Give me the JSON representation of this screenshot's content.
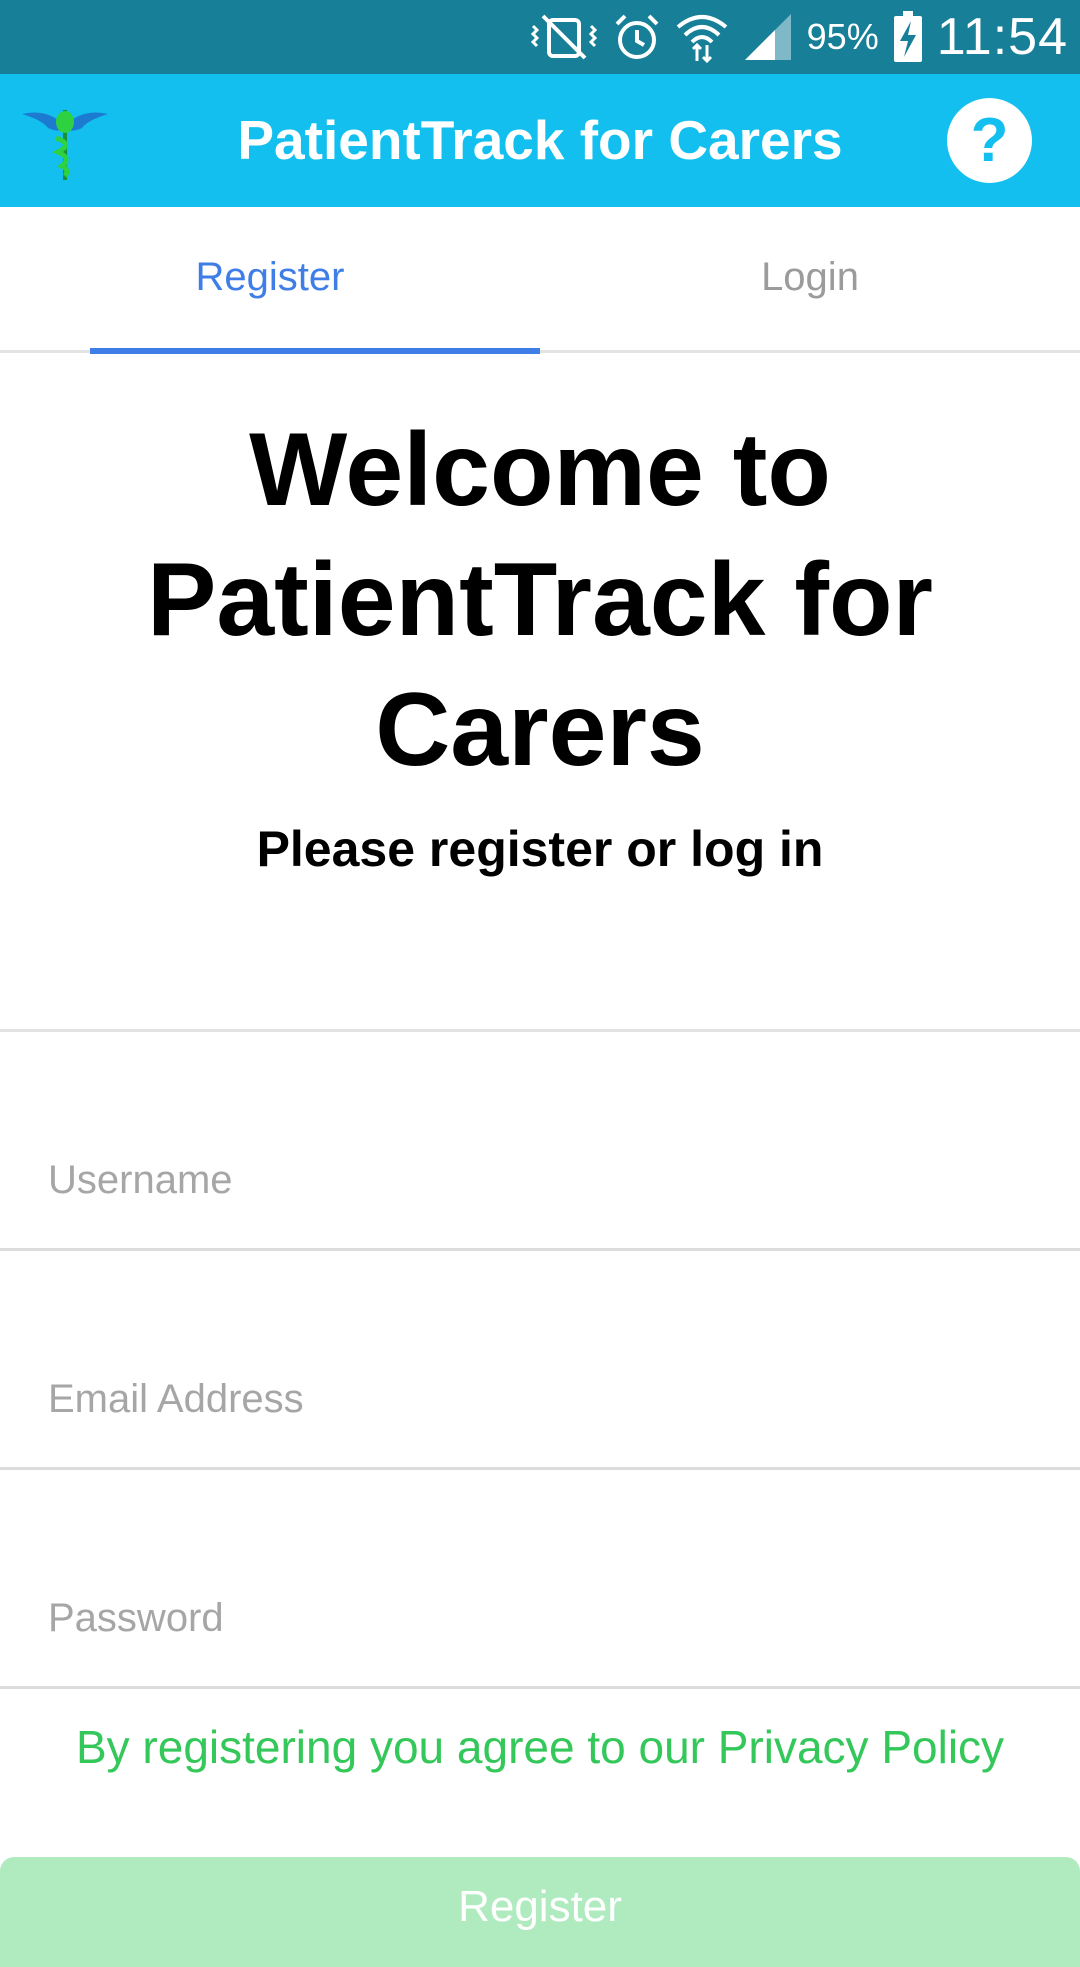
{
  "status_bar": {
    "battery_percent": "95%",
    "time": "11:54",
    "icons": [
      "vibrate-mute-icon",
      "alarm-icon",
      "wifi-icon",
      "signal-icon",
      "battery-charging-icon"
    ]
  },
  "app_bar": {
    "title": "PatientTrack for Carers",
    "help_label": "?",
    "logo_icon": "caduceus-logo-icon"
  },
  "tabs": [
    {
      "label": "Register",
      "active": true
    },
    {
      "label": "Login",
      "active": false
    }
  ],
  "welcome": {
    "title": "Welcome to PatientTrack for Carers",
    "subtitle": "Please register or log in"
  },
  "form": {
    "username_placeholder": "Username",
    "email_placeholder": "Email Address",
    "password_placeholder": "Password",
    "privacy_text": "By registering you agree to our Privacy Policy",
    "register_label": "Register"
  },
  "colors": {
    "status_bar": "#177f97",
    "app_bar": "#13bfee",
    "active_tab": "#3f7ee6",
    "privacy_text": "#34c759",
    "register_button": "#b0ebc0"
  }
}
